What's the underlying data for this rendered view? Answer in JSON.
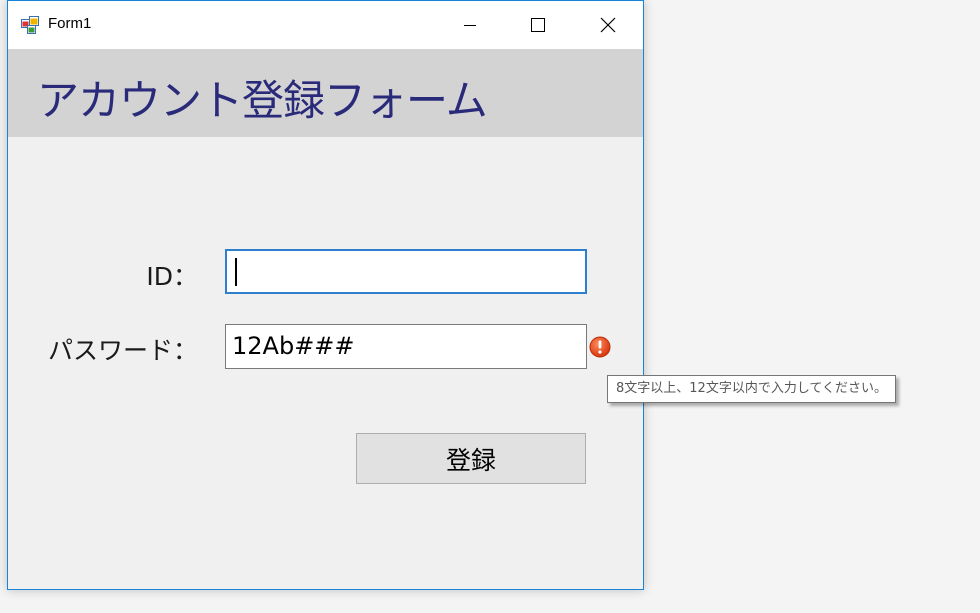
{
  "window": {
    "title": "Form1"
  },
  "header": {
    "title": "アカウント登録フォーム"
  },
  "form": {
    "id_label": "ID：",
    "id_value": "",
    "password_label": "パスワード：",
    "password_value": "12Ab###",
    "register_button": "登録"
  },
  "validation": {
    "tooltip": "8文字以上、12文字以内で入力してください。"
  },
  "colors": {
    "header_text": "#2a2a7a",
    "header_band": "#d3d3d3",
    "window_border": "#1883d7",
    "error_icon": "#e04a1b"
  },
  "icons": {
    "app": "winforms-app-icon",
    "minimize": "minimize-icon",
    "maximize": "maximize-icon",
    "close": "close-icon",
    "error": "error-icon"
  }
}
